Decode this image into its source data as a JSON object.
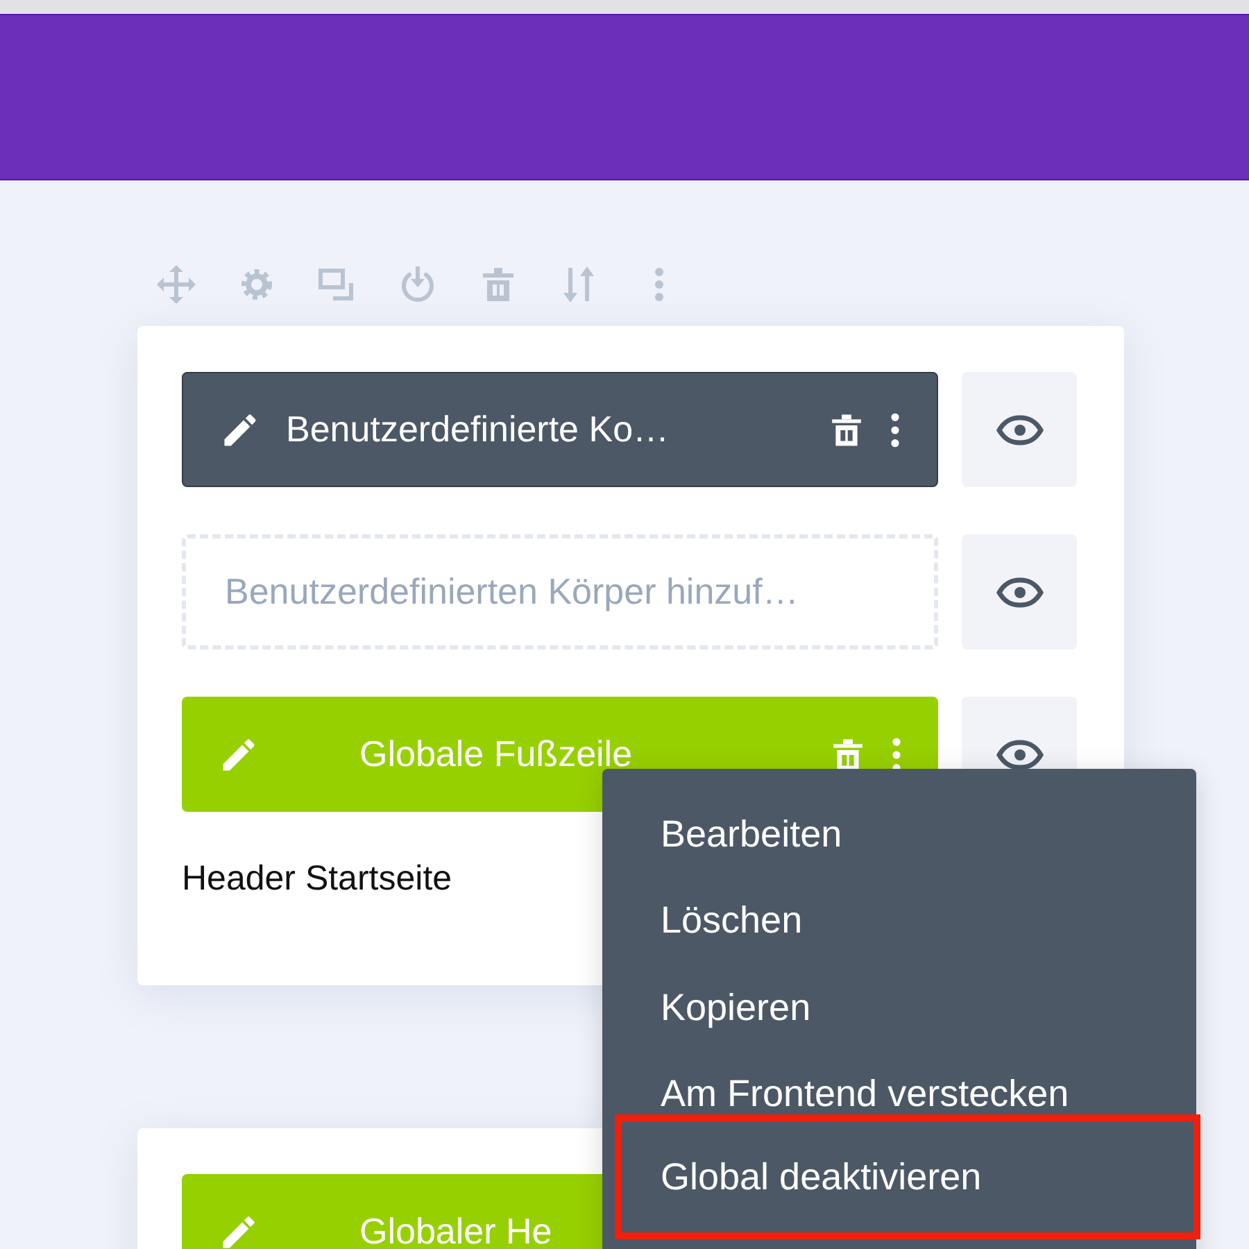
{
  "sections": [
    {
      "rows": [
        {
          "kind": "custom",
          "label": "Benutzerdefinierte Ko…",
          "visible": true
        },
        {
          "kind": "placeholder",
          "label": "Benutzerdefinierten Körper hinzuf…",
          "visible": true
        },
        {
          "kind": "global",
          "label": "Globale Fußzeile",
          "visible": true
        }
      ],
      "title": "Header Startseite"
    },
    {
      "rows": [
        {
          "kind": "global",
          "label": "Globaler He"
        }
      ]
    }
  ],
  "context_menu": [
    {
      "label": "Bearbeiten",
      "highlighted": false
    },
    {
      "label": "Löschen",
      "highlighted": false
    },
    {
      "label": "Kopieren",
      "highlighted": false
    },
    {
      "label": "Am Frontend verstecken",
      "highlighted": false
    },
    {
      "label": "Global deaktivieren",
      "highlighted": true
    }
  ]
}
